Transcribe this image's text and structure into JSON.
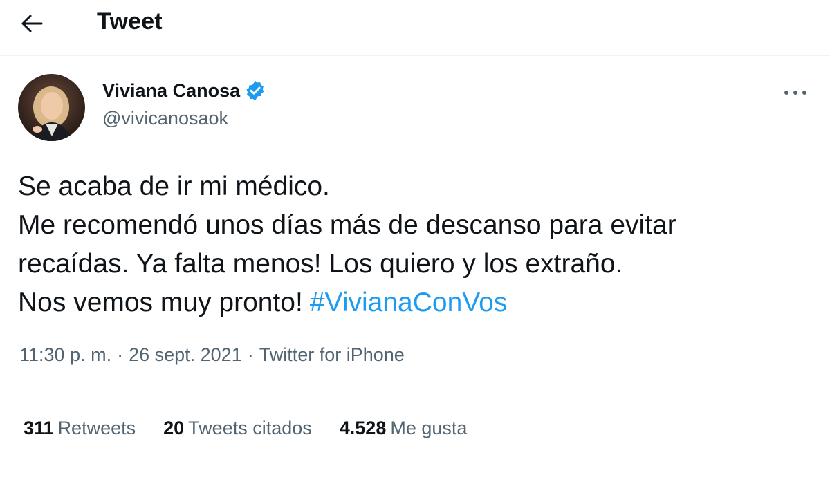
{
  "header": {
    "back_icon": "arrow-left-icon",
    "title": "Tweet"
  },
  "tweet": {
    "author": {
      "name": "Viviana Canosa",
      "handle": "@vivicanosaok",
      "verified": true,
      "verified_color": "#1d9bf0"
    },
    "more_icon": "more-horizontal-icon",
    "text_lines": [
      "Se acaba de ir mi médico.",
      "Me recomendó unos días más de descanso para evitar",
      "recaídas. Ya falta menos! Los quiero y los extraño.",
      "Nos vemos muy pronto!"
    ],
    "hashtag": "#VivianaConVos",
    "time": "11:30 p. m.",
    "separator": "·",
    "date": "26 sept. 2021",
    "source": "Twitter for iPhone",
    "stats": {
      "retweets_count": "311",
      "retweets_label": "Retweets",
      "quotes_count": "20",
      "quotes_label": "Tweets citados",
      "likes_count": "4.528",
      "likes_label": "Me gusta"
    }
  },
  "colors": {
    "link": "#1d9bf0",
    "secondary_text": "#536471",
    "primary_text": "#0f1419",
    "divider": "#eff3f4"
  }
}
